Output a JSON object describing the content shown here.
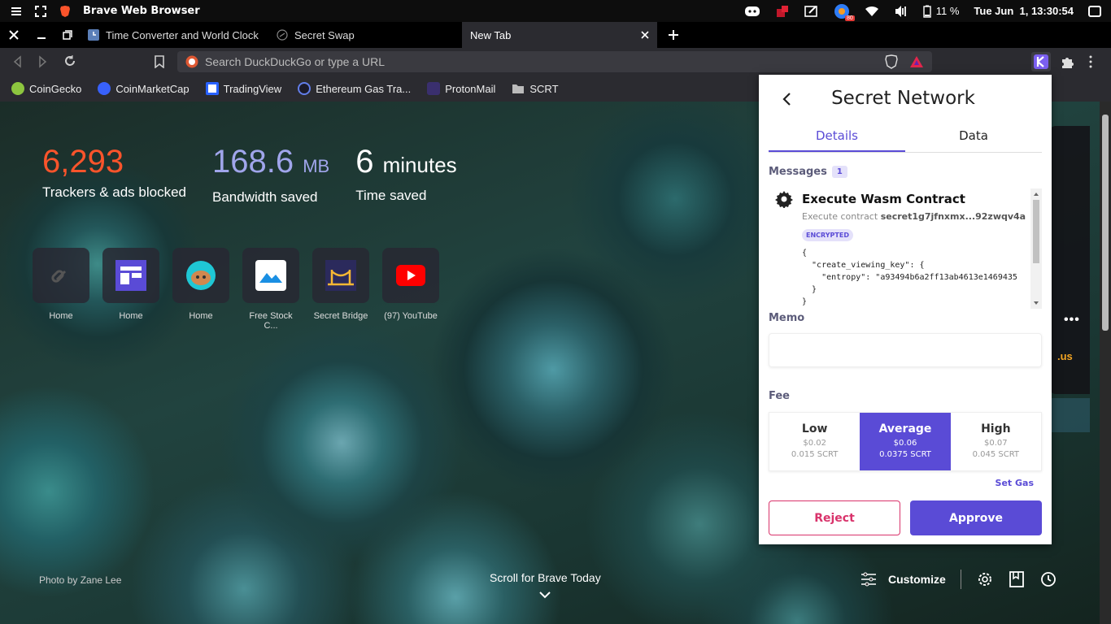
{
  "os": {
    "app_title": "Brave Web Browser",
    "battery": "11 %",
    "datetime": "Tue Jun  1, 13:30:54",
    "notif_count": "80"
  },
  "tabs": [
    {
      "label": "Time Converter and World Clock - Co"
    },
    {
      "label": "Secret Swap"
    },
    {
      "label": "New Tab"
    }
  ],
  "address": {
    "placeholder": "Search DuckDuckGo or type a URL"
  },
  "bookmarks": [
    {
      "label": "CoinGecko",
      "color": "#8dc63f"
    },
    {
      "label": "CoinMarketCap",
      "color": "#3861fb"
    },
    {
      "label": "TradingView",
      "color": "#2962ff"
    },
    {
      "label": "Ethereum Gas Tra...",
      "color": "#627eea"
    },
    {
      "label": "ProtonMail",
      "color": "#6d4aff"
    },
    {
      "label": "SCRT",
      "color": "#bbbbbb"
    }
  ],
  "stats": {
    "trackers": {
      "value": "6,293",
      "label": "Trackers & ads blocked",
      "color": "#fb542b"
    },
    "bandwidth": {
      "value": "168.6",
      "unit": "MB",
      "label": "Bandwidth saved",
      "color": "#a0a5eb"
    },
    "time": {
      "value": "6",
      "unit": "minutes",
      "label": "Time saved",
      "color": "#ffffff"
    }
  },
  "tiles": [
    {
      "label": "Home"
    },
    {
      "label": "Home"
    },
    {
      "label": "Home"
    },
    {
      "label": "Free Stock C..."
    },
    {
      "label": "Secret Bridge"
    },
    {
      "label": "(97) YouTube"
    }
  ],
  "photo_credit": "Photo by Zane Lee",
  "scroll_label": "Scroll for Brave Today",
  "customize_label": "Customize",
  "side_text": ".us",
  "popup": {
    "title": "Secret Network",
    "tabs": [
      "Details",
      "Data"
    ],
    "messages_label": "Messages",
    "messages_count": "1",
    "message": {
      "title": "Execute Wasm Contract",
      "sub_prefix": "Execute contract",
      "contract": "secret1g7jfnxmx...92zwqv4a",
      "badge": "ENCRYPTED",
      "code": "{\n  \"create_viewing_key\": {\n    \"entropy\": \"a93494b6a2ff13ab4613e1469435\n  }\n}"
    },
    "memo_label": "Memo",
    "fee_label": "Fee",
    "fees": [
      {
        "name": "Low",
        "usd": "$0.02",
        "scrt": "0.015 SCRT"
      },
      {
        "name": "Average",
        "usd": "$0.06",
        "scrt": "0.0375 SCRT"
      },
      {
        "name": "High",
        "usd": "$0.07",
        "scrt": "0.045 SCRT"
      }
    ],
    "set_gas": "Set Gas",
    "reject": "Reject",
    "approve": "Approve"
  }
}
